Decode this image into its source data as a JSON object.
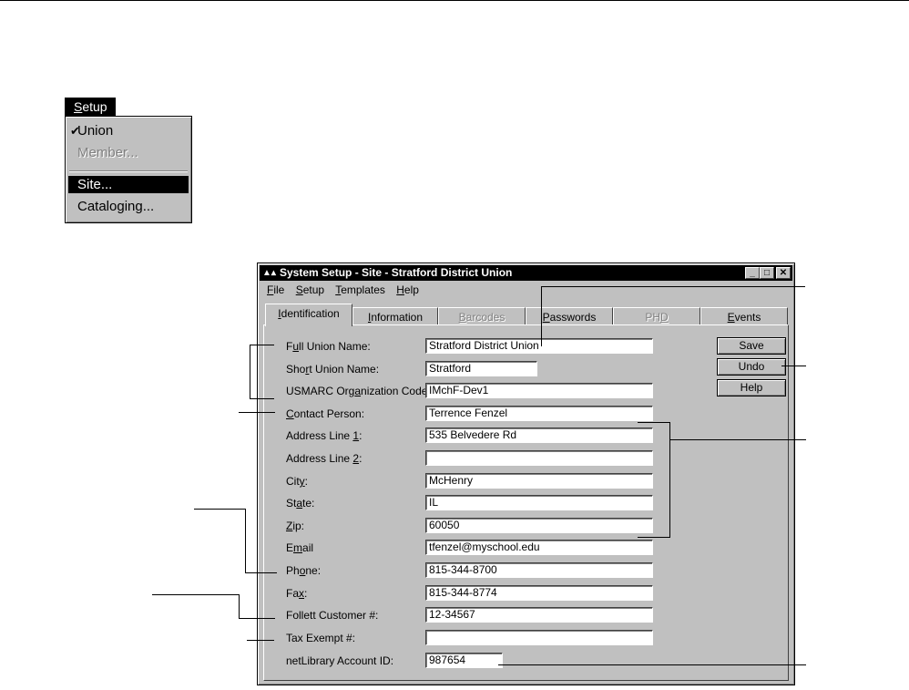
{
  "setup_menu": {
    "title_prefix": "S",
    "title_rest": "etup",
    "items": [
      {
        "label": "Union",
        "checked": true
      },
      {
        "label": "Member...",
        "disabled": true
      },
      {
        "label": "Site...",
        "selected": true
      },
      {
        "label": "Cataloging..."
      }
    ],
    "check_glyph": "✔"
  },
  "window": {
    "title": "System Setup - Site - Stratford District Union",
    "minimize": "_",
    "maximize": "□",
    "close": "✕",
    "menu": [
      {
        "u": "F",
        "rest": "ile"
      },
      {
        "u": "S",
        "rest": "etup"
      },
      {
        "u": "T",
        "rest": "emplates"
      },
      {
        "u": "H",
        "rest": "elp"
      }
    ],
    "tabs": [
      {
        "u": "I",
        "rest": "dentification",
        "active": true
      },
      {
        "u": "I",
        "rest": "nformation"
      },
      {
        "u": "B",
        "rest": "arcodes",
        "disabled": true
      },
      {
        "u": "P",
        "rest": "asswords"
      },
      {
        "pre": "PH",
        "u": "D",
        "rest": "",
        "disabled": true
      },
      {
        "u": "E",
        "rest": "vents"
      }
    ]
  },
  "form": {
    "labels": {
      "full_union_name": {
        "pre": "F",
        "u": "u",
        "post": "ll Union Name:"
      },
      "short_union_name": {
        "pre": "Sho",
        "u": "r",
        "post": "t Union Name:"
      },
      "usmarc": {
        "pre": "USMARC Org",
        "u": "a",
        "post": "nization Code"
      },
      "contact": {
        "pre": "",
        "u": "C",
        "post": "ontact Person:"
      },
      "addr1": {
        "pre": "Address Line ",
        "u": "1",
        "post": ":"
      },
      "addr2": {
        "pre": "Address Line ",
        "u": "2",
        "post": ":"
      },
      "city": {
        "pre": "Cit",
        "u": "y",
        "post": ":"
      },
      "state": {
        "pre": "St",
        "u": "a",
        "post": "te:"
      },
      "zip": {
        "pre": "",
        "u": "Z",
        "post": "ip:"
      },
      "email": {
        "pre": "E",
        "u": "m",
        "post": "ail"
      },
      "phone": {
        "pre": "Ph",
        "u": "o",
        "post": "ne:"
      },
      "fax": {
        "pre": "Fa",
        "u": "x",
        "post": ":"
      },
      "follett": {
        "pre": "Follett Customer #:",
        "u": "",
        "post": ""
      },
      "tax": {
        "pre": "Tax Exempt #:",
        "u": "",
        "post": ""
      },
      "netlibrary": {
        "pre": "netLibrary Account ID:",
        "u": "",
        "post": ""
      }
    },
    "values": {
      "full_union_name": "Stratford District Union",
      "short_union_name": "Stratford",
      "usmarc": "IMchF-Dev1",
      "contact": "Terrence Fenzel",
      "addr1": "535 Belvedere Rd",
      "addr2": "",
      "city": "McHenry",
      "state": "IL",
      "zip": "60050",
      "email": "tfenzel@myschool.edu",
      "phone": "815-344-8700",
      "fax": "815-344-8774",
      "follett": "12-34567",
      "tax": "",
      "netlibrary": "987654"
    }
  },
  "buttons": {
    "save": "Save",
    "undo": "Undo",
    "help": "Help"
  }
}
